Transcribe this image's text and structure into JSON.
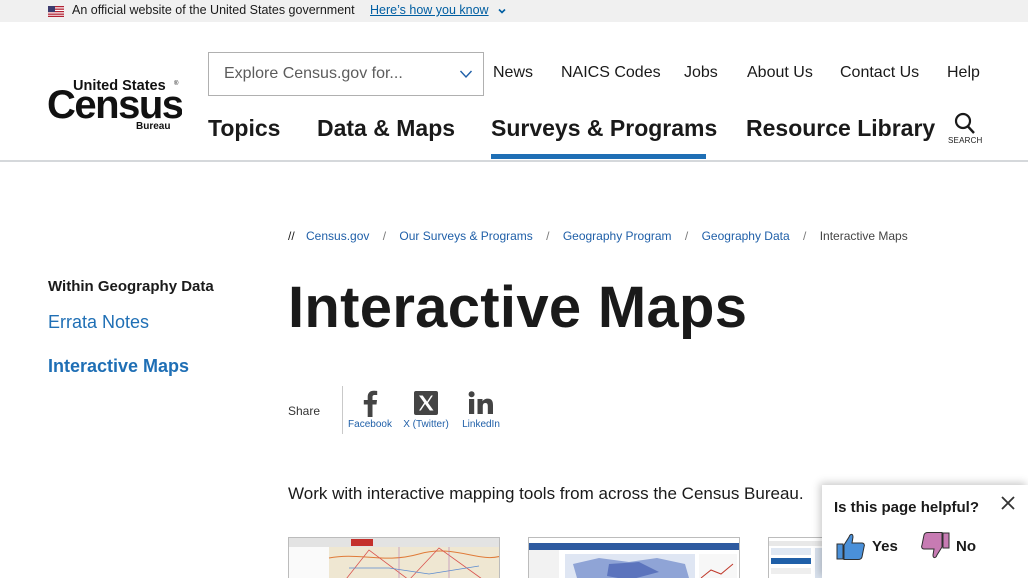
{
  "gov_banner": {
    "text": "An official website of the United States government",
    "link": "Here’s how you know"
  },
  "logo": {
    "line1": "United States",
    "line2": "Census",
    "line3": "Bureau",
    "reg": "®"
  },
  "search": {
    "placeholder": "Explore Census.gov for...",
    "button_label": "SEARCH"
  },
  "utility_nav": [
    "News",
    "NAICS Codes",
    "Jobs",
    "About Us",
    "Contact Us",
    "Help"
  ],
  "main_nav": {
    "items": [
      "Topics",
      "Data & Maps",
      "Surveys & Programs",
      "Resource Library"
    ],
    "active": "Surveys & Programs"
  },
  "breadcrumb": {
    "lead": "//",
    "items": [
      "Census.gov",
      "Our Surveys & Programs",
      "Geography Program",
      "Geography Data"
    ],
    "current": "Interactive Maps"
  },
  "sidebar": {
    "heading": "Within Geography Data",
    "items": [
      {
        "label": "Errata Notes",
        "active": false
      },
      {
        "label": "Interactive Maps",
        "active": true
      }
    ]
  },
  "page": {
    "title": "Interactive Maps",
    "intro": "Work with interactive mapping tools from across the Census Bureau."
  },
  "share": {
    "label": "Share",
    "items": [
      {
        "label": "Facebook",
        "icon": "facebook-icon"
      },
      {
        "label": "X (Twitter)",
        "icon": "x-twitter-icon"
      },
      {
        "label": "LinkedIn",
        "icon": "linkedin-icon"
      }
    ]
  },
  "feedback": {
    "question": "Is this page helpful?",
    "yes": "Yes",
    "no": "No"
  },
  "colors": {
    "link": "#1f6fb5",
    "accent_underline": "#1f6fb5",
    "gov_link": "#005ea2",
    "thumb_up": "#4a90d9",
    "thumb_down": "#c77bb3"
  }
}
